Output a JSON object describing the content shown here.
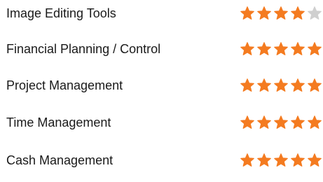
{
  "colors": {
    "star_filled": "#f47b20",
    "star_empty": "#cfcfcf",
    "label_text": "#1a1a1a"
  },
  "ratings": [
    {
      "label": "Image Editing Tools",
      "stars": 4,
      "max": 5
    },
    {
      "label": "Financial Planning / Control",
      "stars": 5,
      "max": 5
    },
    {
      "label": "Project Management",
      "stars": 5,
      "max": 5
    },
    {
      "label": "Time Management",
      "stars": 5,
      "max": 5
    },
    {
      "label": "Cash Management",
      "stars": 5,
      "max": 5
    }
  ]
}
